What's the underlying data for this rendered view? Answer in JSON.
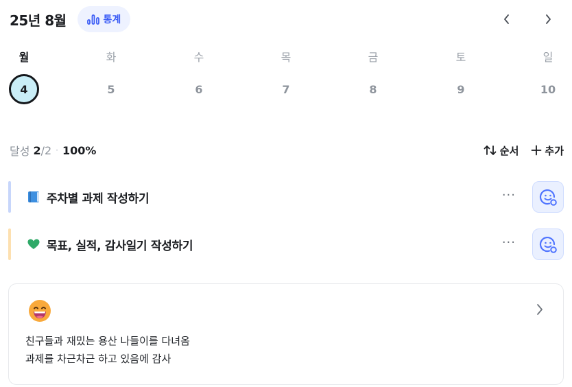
{
  "header": {
    "month_title": "25년 8월",
    "stats_label": "통계",
    "accent": "#3b5cf6"
  },
  "week": {
    "days": [
      {
        "dow": "월",
        "date": "4",
        "active": true
      },
      {
        "dow": "화",
        "date": "5",
        "active": false
      },
      {
        "dow": "수",
        "date": "6",
        "active": false
      },
      {
        "dow": "목",
        "date": "7",
        "active": false
      },
      {
        "dow": "금",
        "date": "8",
        "active": false
      },
      {
        "dow": "토",
        "date": "9",
        "active": false
      },
      {
        "dow": "일",
        "date": "10",
        "active": false
      }
    ]
  },
  "summary": {
    "label": "달성",
    "done": "2",
    "total": "/2",
    "separator": "·",
    "percent": "100%",
    "order_label": "순서",
    "add_label": "추가"
  },
  "tasks": [
    {
      "icon": "blue-book-icon",
      "title": "주차별 과제 작성하기",
      "bar_color": "#c7d6fb",
      "more": "···"
    },
    {
      "icon": "green-heart-icon",
      "title": "목표, 실적, 감사일기 작성하기",
      "bar_color": "#fde0b0",
      "more": "···"
    }
  ],
  "journal": {
    "emoji": "grinning-face-icon",
    "lines": [
      "친구들과 재밌는 용산 나들이를 다녀옴",
      "과제를 차근차근 하고 있음에 감사"
    ]
  }
}
